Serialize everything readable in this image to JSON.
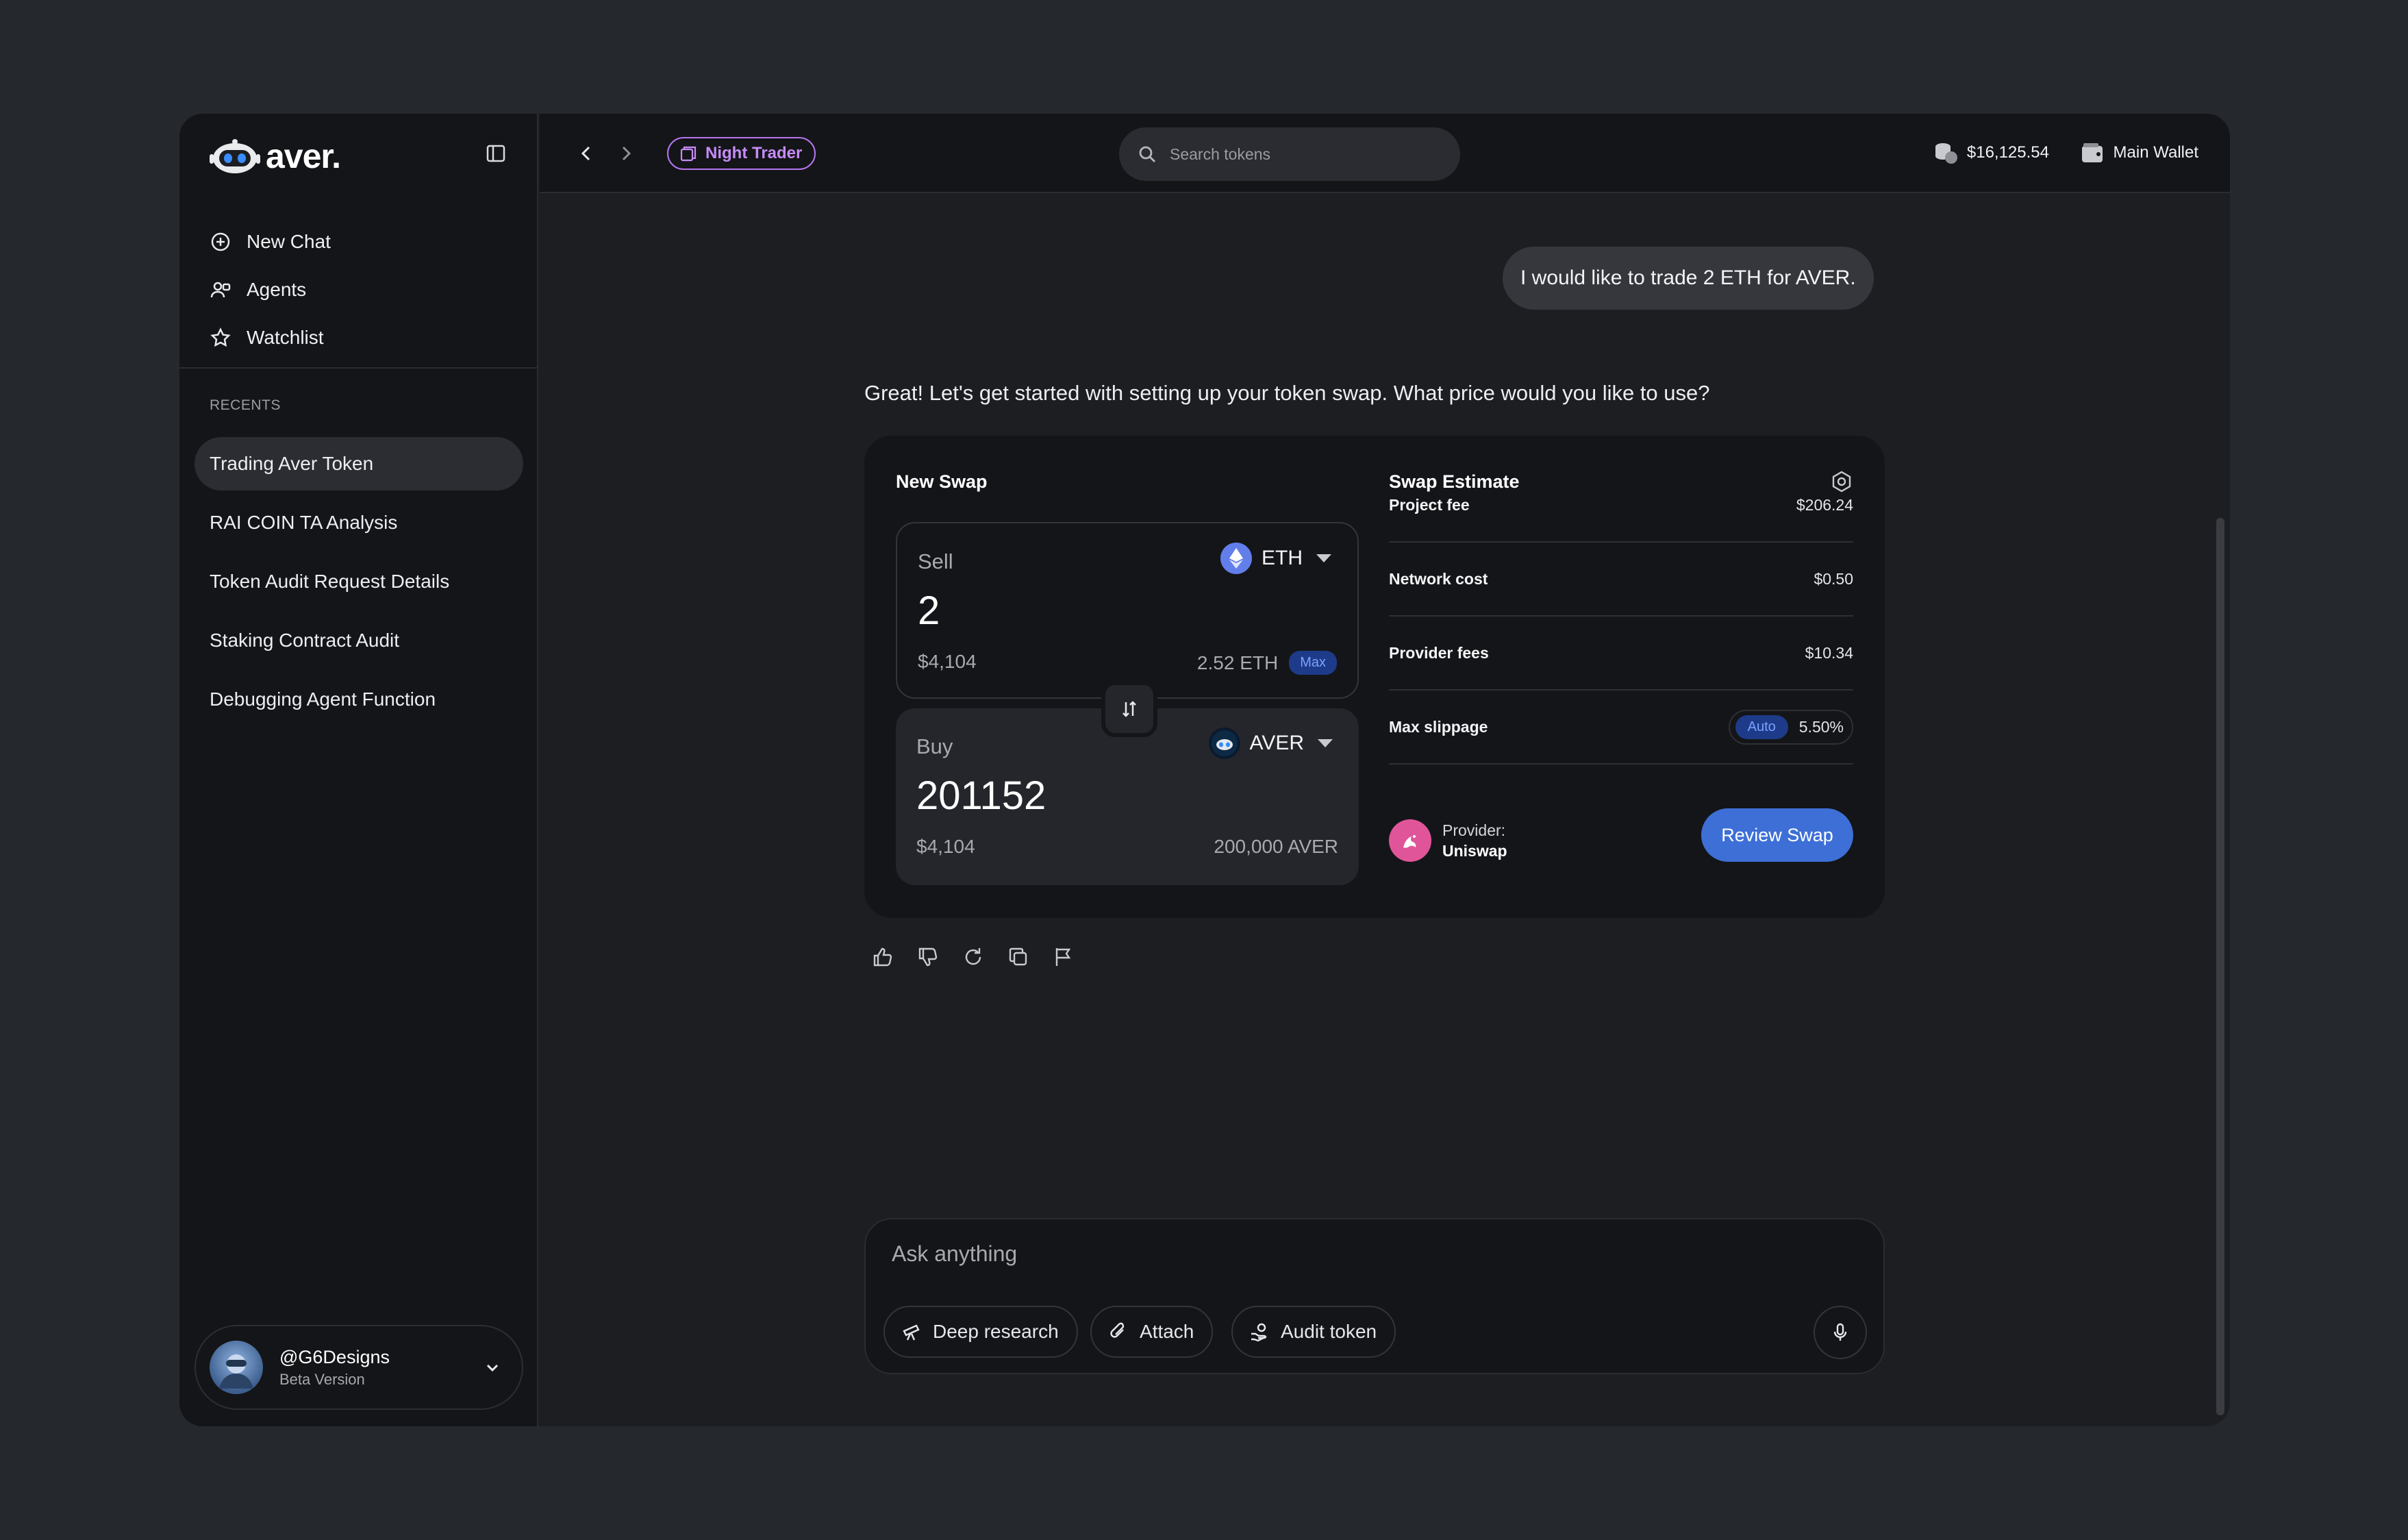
{
  "app": {
    "name": "aver."
  },
  "sidebar": {
    "nav": [
      {
        "label": "New Chat",
        "icon": "plus-circle-icon"
      },
      {
        "label": "Agents",
        "icon": "agents-icon"
      },
      {
        "label": "Watchlist",
        "icon": "star-icon"
      }
    ],
    "recents_title": "RECENTS",
    "recents": [
      {
        "label": "Trading Aver Token",
        "active": true
      },
      {
        "label": "RAI COIN TA Analysis"
      },
      {
        "label": "Token Audit Request Details"
      },
      {
        "label": "Staking Contract Audit"
      },
      {
        "label": "Debugging Agent Function"
      }
    ],
    "profile": {
      "name": "@G6Designs",
      "subtitle": "Beta Version"
    }
  },
  "topbar": {
    "agent_badge": "Night Trader",
    "search_placeholder": "Search tokens",
    "balance": "$16,125.54",
    "wallet": "Main Wallet"
  },
  "chat": {
    "user_message": "I would like to trade 2 ETH for AVER.",
    "assistant_message": "Great! Let's get started with setting up your token swap. What price would you like to use?"
  },
  "swap": {
    "title": "New Swap",
    "sell": {
      "label": "Sell",
      "token": "ETH",
      "amount": "2",
      "usd": "$4,104",
      "balance": "2.52 ETH",
      "max_label": "Max"
    },
    "buy": {
      "label": "Buy",
      "token": "AVER",
      "amount": "201152",
      "usd": "$4,104",
      "balance": "200,000 AVER"
    },
    "estimate": {
      "title": "Swap Estimate",
      "rows": [
        {
          "label": "Project fee",
          "value": "$206.24"
        },
        {
          "label": "Network cost",
          "value": "$0.50"
        },
        {
          "label": "Provider fees",
          "value": "$10.34"
        }
      ],
      "slippage_label": "Max slippage",
      "slippage_mode": "Auto",
      "slippage_value": "5.50%",
      "provider_label": "Provider:",
      "provider_name": "Uniswap",
      "review_button": "Review Swap"
    }
  },
  "composer": {
    "placeholder": "Ask anything",
    "chips": [
      "Deep research",
      "Attach",
      "Audit token"
    ]
  },
  "colors": {
    "accent": "#3d6fd6",
    "agent_badge": "#c68cf8",
    "pill_blue": "#1e3b8a"
  }
}
